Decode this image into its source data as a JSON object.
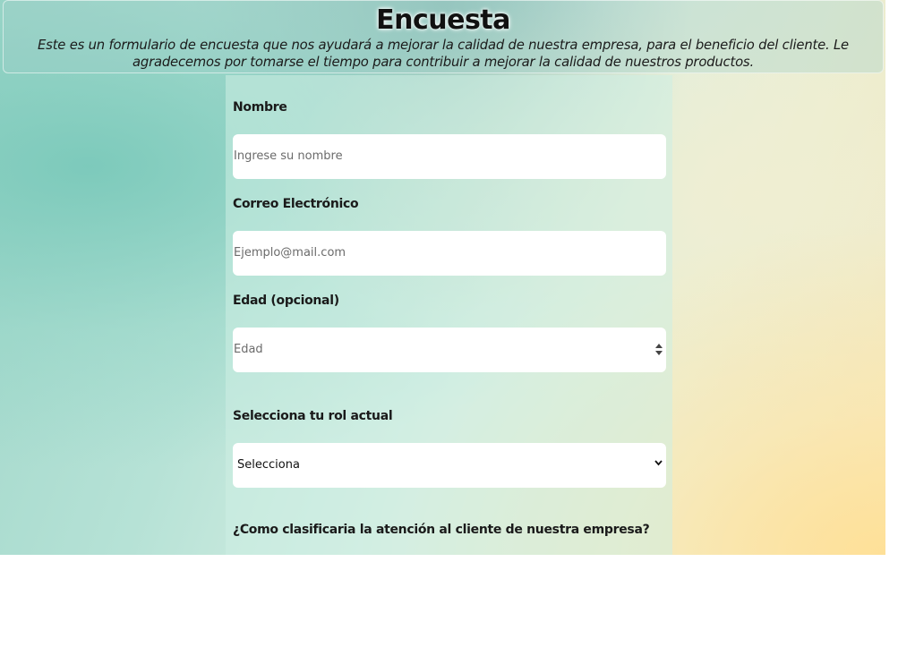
{
  "header": {
    "title": "Encuesta",
    "description": "Este es un formulario de encuesta que nos ayudará a mejorar la calidad de nuestra empresa, para el beneficio del cliente. Le agradecemos por tomarse el tiempo para contribuir a mejorar la calidad de nuestros productos."
  },
  "form": {
    "name": {
      "label": "Nombre",
      "placeholder": "Ingrese su nombre"
    },
    "email": {
      "label": "Correo Electrónico",
      "placeholder": "Ejemplo@mail.com"
    },
    "age": {
      "label": "Edad (opcional)",
      "placeholder": "Edad"
    },
    "role": {
      "label": "Selecciona tu rol actual",
      "selected": "Selecciona"
    },
    "rating_question": "¿Como clasificaria la atención al cliente de nuestra empresa?"
  },
  "icons": {
    "age_spinner": "spinner-arrows-icon",
    "role_dropdown": "chevron-down-icon"
  }
}
